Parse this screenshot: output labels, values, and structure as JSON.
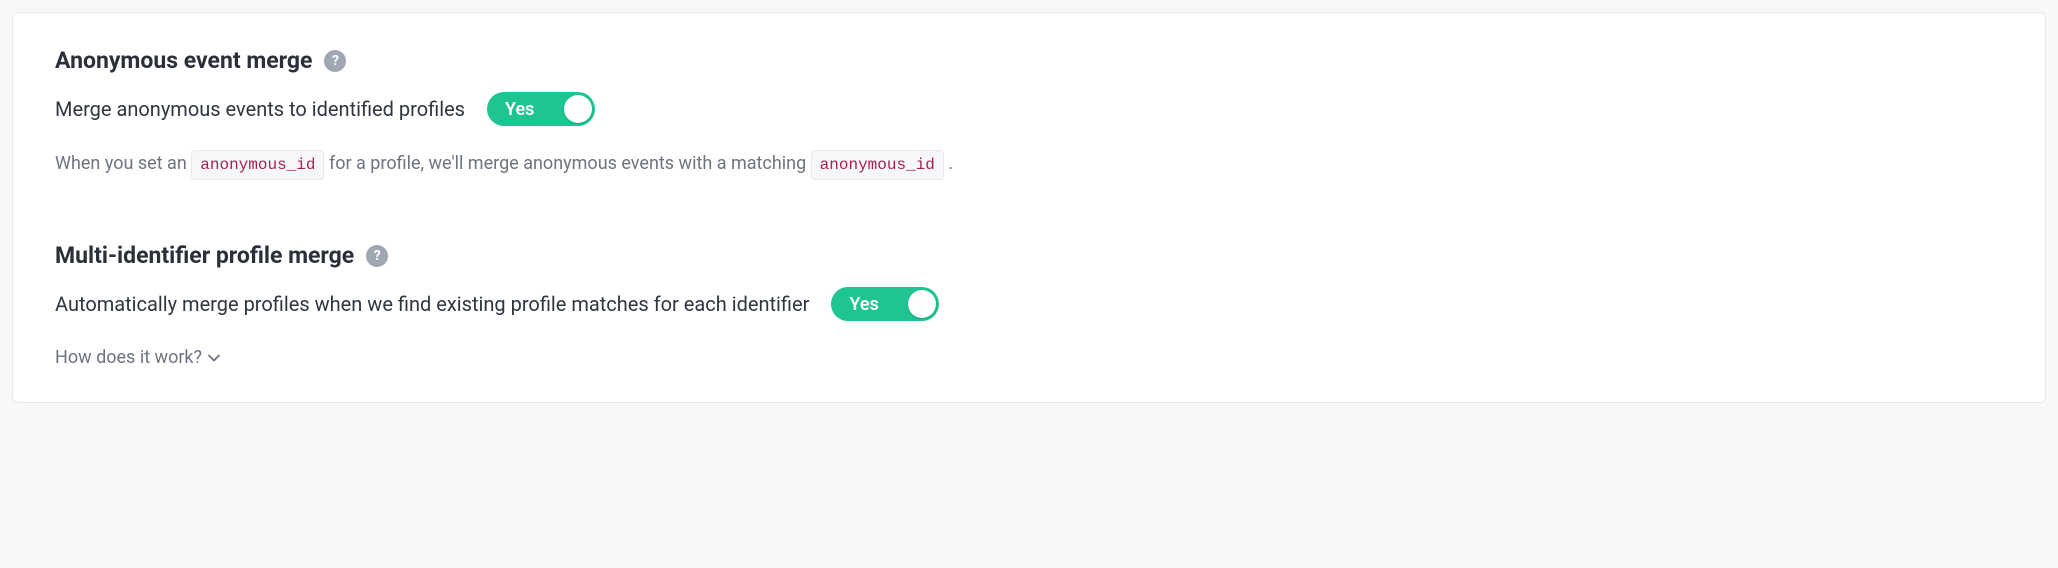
{
  "section1": {
    "title": "Anonymous event merge",
    "help_icon": "?",
    "control_label": "Merge anonymous events to identified profiles",
    "toggle_label": "Yes",
    "desc_part1": "When you set an",
    "code1": "anonymous_id",
    "desc_part2": "for a profile, we'll merge anonymous events with a matching",
    "code2": "anonymous_id",
    "desc_part3": "."
  },
  "section2": {
    "title": "Multi-identifier profile merge",
    "help_icon": "?",
    "control_label": "Automatically merge profiles when we find existing profile matches for each identifier",
    "toggle_label": "Yes",
    "expand_text": "How does it work?"
  }
}
